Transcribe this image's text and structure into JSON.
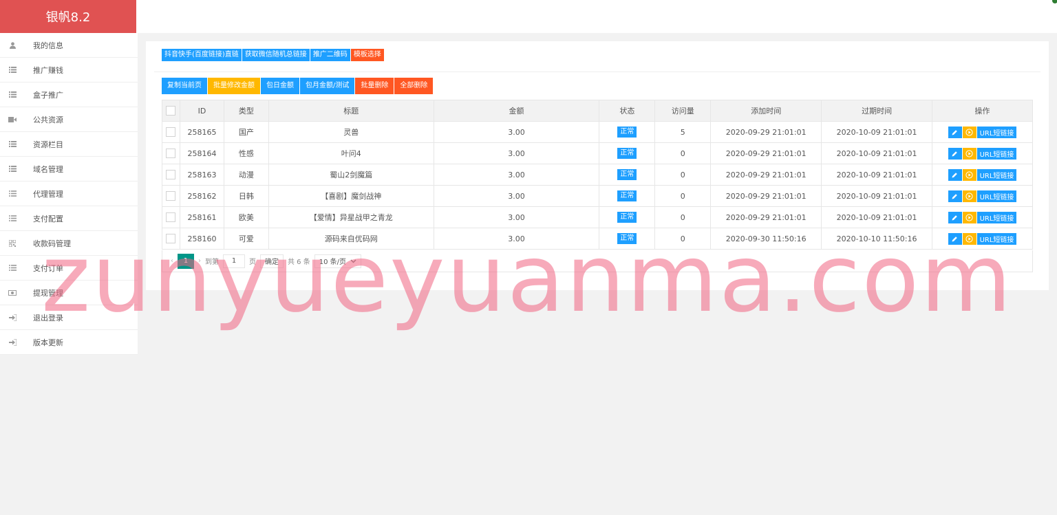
{
  "brand": {
    "title": "银帆8.2"
  },
  "sidebar": {
    "items": [
      {
        "label": "我的信息",
        "icon": "user-icon"
      },
      {
        "label": "推广赚钱",
        "icon": "list-icon"
      },
      {
        "label": "盒子推广",
        "icon": "list-icon"
      },
      {
        "label": "公共资源",
        "icon": "video-icon"
      },
      {
        "label": "资源栏目",
        "icon": "list-icon"
      },
      {
        "label": "域名管理",
        "icon": "list-icon"
      },
      {
        "label": "代理管理",
        "icon": "bullet-list-icon"
      },
      {
        "label": "支付配置",
        "icon": "bullet-list-icon"
      },
      {
        "label": "收款码管理",
        "icon": "qrcode-icon"
      },
      {
        "label": "支付订单",
        "icon": "bullet-list-icon"
      },
      {
        "label": "提现管理",
        "icon": "money-icon"
      },
      {
        "label": "退出登录",
        "icon": "sign-in-icon"
      },
      {
        "label": "版本更新",
        "icon": "sign-in-icon"
      }
    ]
  },
  "toolbar1": {
    "douyin": "抖音快手(百度链接)直链",
    "wechat": "获取微信随机总链接",
    "qrcode": "推广二维码",
    "template": "模板选择"
  },
  "toolbar2": {
    "copy": "复制当前页",
    "batch_edit": "批量修改金额",
    "daily": "包日金额",
    "monthly": "包月金额/测试",
    "batch_delete": "批量删除",
    "delete_all": "全部删除"
  },
  "table": {
    "headers": [
      "ID",
      "类型",
      "标题",
      "金额",
      "状态",
      "访问量",
      "添加时间",
      "过期时间",
      "操作"
    ],
    "url_label": "URL短链接",
    "rows": [
      {
        "id": "258165",
        "type": "国产",
        "title": "灵兽",
        "amount": "3.00",
        "status": "正常",
        "visits": "5",
        "added": "2020-09-29 21:01:01",
        "expires": "2020-10-09 21:01:01"
      },
      {
        "id": "258164",
        "type": "性感",
        "title": "叶问4",
        "amount": "3.00",
        "status": "正常",
        "visits": "0",
        "added": "2020-09-29 21:01:01",
        "expires": "2020-10-09 21:01:01"
      },
      {
        "id": "258163",
        "type": "动漫",
        "title": "蜀山2剑魔篇",
        "amount": "3.00",
        "status": "正常",
        "visits": "0",
        "added": "2020-09-29 21:01:01",
        "expires": "2020-10-09 21:01:01"
      },
      {
        "id": "258162",
        "type": "日韩",
        "title": "【喜剧】魔剑战神",
        "amount": "3.00",
        "status": "正常",
        "visits": "0",
        "added": "2020-09-29 21:01:01",
        "expires": "2020-10-09 21:01:01"
      },
      {
        "id": "258161",
        "type": "欧美",
        "title": "【爱情】异星战甲之青龙",
        "amount": "3.00",
        "status": "正常",
        "visits": "0",
        "added": "2020-09-29 21:01:01",
        "expires": "2020-10-09 21:01:01"
      },
      {
        "id": "258160",
        "type": "可爱",
        "title": "源码来自优码网",
        "amount": "3.00",
        "status": "正常",
        "visits": "0",
        "added": "2020-09-30 11:50:16",
        "expires": "2020-10-10 11:50:16"
      }
    ]
  },
  "pager": {
    "prev": "‹",
    "next": "›",
    "current": "1",
    "goto_label": "到第",
    "page_value": "1",
    "page_unit": "页",
    "confirm": "确定",
    "total": "共 6 条",
    "per_page": "10 条/页"
  },
  "watermark": "zunyueyuanma.com",
  "colors": {
    "brand": "#e05252",
    "blue": "#1e9fff",
    "orange": "#ff5722",
    "yellow": "#ffb800",
    "teal": "#009688"
  }
}
